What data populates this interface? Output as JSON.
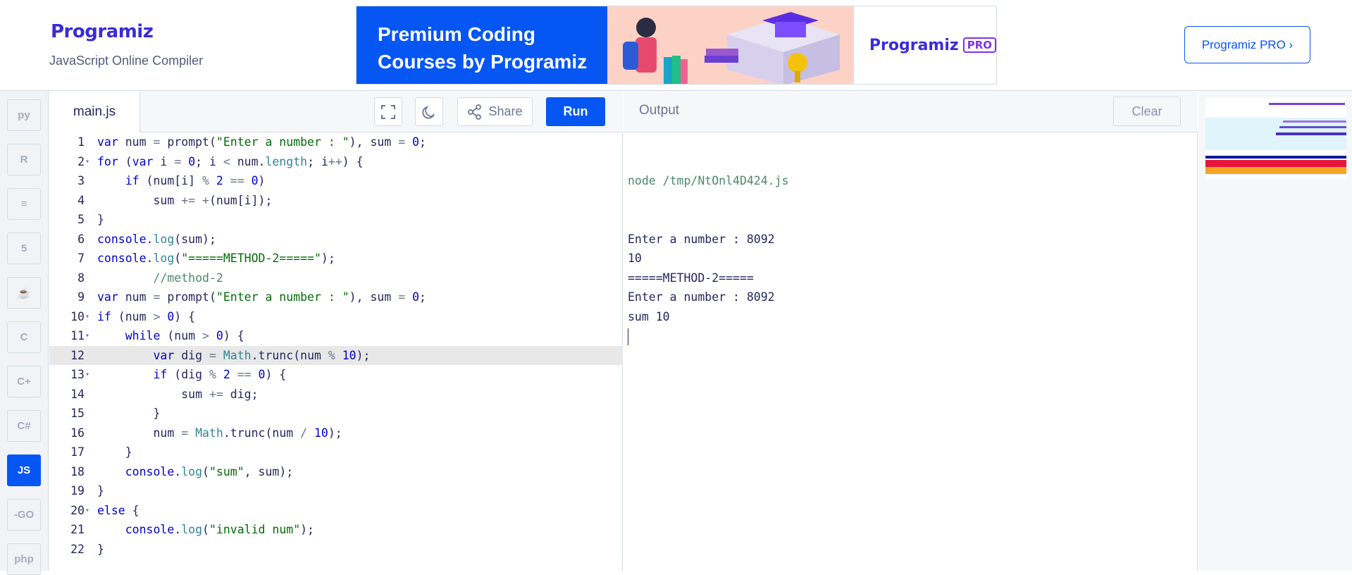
{
  "header": {
    "logo_text": "Programiz",
    "subtitle": "JavaScript Online Compiler",
    "banner": {
      "headline_line1": "Premium Coding",
      "headline_line2": "Courses by Programiz",
      "brand": "Programiz",
      "brand_tag": "PRO"
    },
    "pro_button": "Programiz PRO ›"
  },
  "languages": [
    {
      "name": "python",
      "label": "py"
    },
    {
      "name": "r",
      "label": "R"
    },
    {
      "name": "sql",
      "label": "≡"
    },
    {
      "name": "html",
      "label": "5"
    },
    {
      "name": "java",
      "label": "☕"
    },
    {
      "name": "c",
      "label": "C"
    },
    {
      "name": "cpp",
      "label": "C+"
    },
    {
      "name": "csharp",
      "label": "C#"
    },
    {
      "name": "javascript",
      "label": "JS",
      "active": true
    },
    {
      "name": "go",
      "label": "-GO"
    },
    {
      "name": "php",
      "label": "php"
    }
  ],
  "editor": {
    "tab": "main.js",
    "share_label": "Share",
    "run_label": "Run",
    "current_line": 12,
    "lines": [
      "var num = prompt(\"Enter a number : \"), sum = 0;",
      "for (var i = 0; i < num.length; i++) {",
      "    if (num[i] % 2 == 0)",
      "        sum += +(num[i]);",
      "}",
      "console.log(sum);",
      "console.log(\"=====METHOD-2=====\");",
      "        //method-2",
      "var num = prompt(\"Enter a number : \"), sum = 0;",
      "if (num > 0) {",
      "    while (num > 0) {",
      "        var dig = Math.trunc(num % 10);",
      "        if (dig % 2 == 0) {",
      "            sum += dig;",
      "        }",
      "        num = Math.trunc(num / 10);",
      "    }",
      "    console.log(\"sum\", sum);",
      "}",
      "else {",
      "    console.log(\"invalid num\");",
      "}"
    ],
    "fold_lines": [
      2,
      10,
      11,
      13,
      20
    ]
  },
  "output": {
    "title": "Output",
    "clear_label": "Clear",
    "command": "node /tmp/NtOnl4D424.js",
    "lines": [
      "Enter a number : 8092",
      "10",
      "=====METHOD-2=====",
      "Enter a number : 8092",
      "sum 10"
    ]
  },
  "colors": {
    "accent": "#0556f3",
    "border": "#d3dce4",
    "current_line": "#e8e8e8"
  }
}
